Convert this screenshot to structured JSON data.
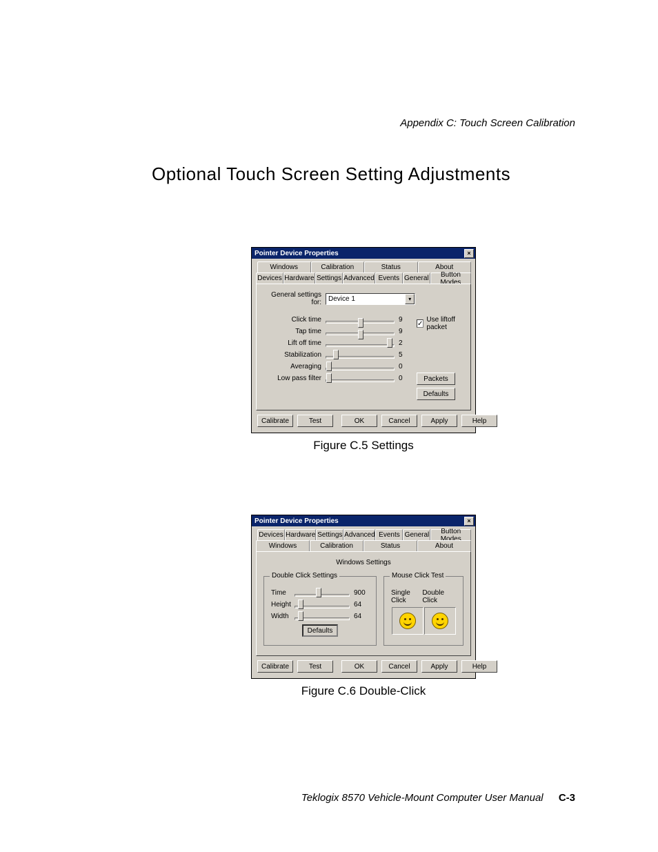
{
  "page": {
    "header_context": "Appendix C: Touch Screen Calibration",
    "section_title": "Optional Touch Screen Setting Adjustments",
    "footer_text": "Teklogix 8570 Vehicle-Mount Computer User Manual",
    "page_number": "C-3"
  },
  "dlg1": {
    "title": "Pointer Device Properties",
    "tabs_back": [
      "Windows",
      "Calibration",
      "Status",
      "About"
    ],
    "tabs_front": [
      "Devices",
      "Hardware",
      "Settings",
      "Advanced",
      "Events",
      "General",
      "Button Modes"
    ],
    "active_tab": "Settings",
    "settings_for_label": "General settings for:",
    "device_value": "Device 1",
    "use_liftoff_label": "Use liftoff packet",
    "use_liftoff_checked": true,
    "sliders": [
      {
        "label": "Click time",
        "value": "9"
      },
      {
        "label": "Tap time",
        "value": "9"
      },
      {
        "label": "Lift off time",
        "value": "2"
      },
      {
        "label": "Stabilization",
        "value": "5"
      },
      {
        "label": "Averaging",
        "value": "0"
      },
      {
        "label": "Low pass filter",
        "value": "0"
      }
    ],
    "btn_packets": "Packets",
    "btn_defaults": "Defaults",
    "btn_calibrate": "Calibrate",
    "btn_test": "Test",
    "btn_ok": "OK",
    "btn_cancel": "Cancel",
    "btn_apply": "Apply",
    "btn_help": "Help",
    "caption": "Figure C.5   Settings"
  },
  "dlg2": {
    "title": "Pointer Device Properties",
    "tabs_back": [
      "Devices",
      "Hardware",
      "Settings",
      "Advanced",
      "Events",
      "General",
      "Button Modes"
    ],
    "tabs_front": [
      "Windows",
      "Calibration",
      "Status",
      "About"
    ],
    "active_tab": "Windows",
    "subtitle": "Windows Settings",
    "group_double": "Double Click Settings",
    "group_test": "Mouse Click Test",
    "lbl_single": "Single Click",
    "lbl_double": "Double Click",
    "sliders": [
      {
        "label": "Time",
        "value": "900"
      },
      {
        "label": "Height",
        "value": "64"
      },
      {
        "label": "Width",
        "value": "64"
      }
    ],
    "btn_defaults": "Defaults",
    "btn_calibrate": "Calibrate",
    "btn_test": "Test",
    "btn_ok": "OK",
    "btn_cancel": "Cancel",
    "btn_apply": "Apply",
    "btn_help": "Help",
    "caption": "Figure C.6   Double-Click"
  }
}
